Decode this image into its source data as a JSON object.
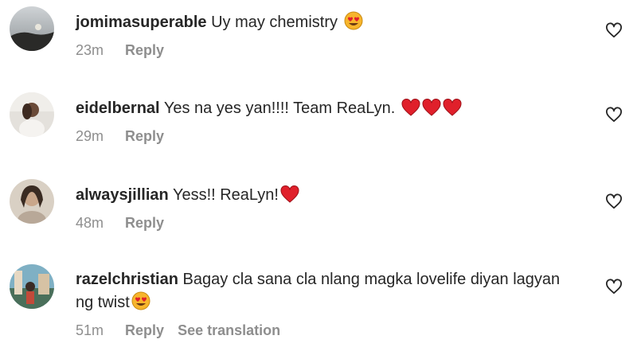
{
  "comments": [
    {
      "username": "jomimasuperable",
      "text": "Uy may chemistry",
      "emojis": [
        "heart-eyes-emoji"
      ],
      "time": "23m",
      "reply_label": "Reply",
      "translate_label": ""
    },
    {
      "username": "eidelbernal",
      "text": "Yes na yes yan!!!! Team ReaLyn.",
      "emojis": [
        "red-heart-emoji",
        "red-heart-emoji",
        "red-heart-emoji"
      ],
      "time": "29m",
      "reply_label": "Reply",
      "translate_label": ""
    },
    {
      "username": "alwaysjillian",
      "text": "Yess!! ReaLyn!",
      "emojis": [
        "red-heart-emoji"
      ],
      "time": "48m",
      "reply_label": "Reply",
      "translate_label": ""
    },
    {
      "username": "razelchristian",
      "text": "Bagay cla sana cla nlang magka lovelife diyan lagyan ng twist",
      "emojis": [
        "heart-eyes-emoji"
      ],
      "time": "51m",
      "reply_label": "Reply",
      "translate_label": "See translation"
    }
  ],
  "icons": {
    "like": "heart-outline-icon"
  },
  "colors": {
    "text": "#262626",
    "secondary": "#8e8e8e",
    "heart": "#e0202b"
  }
}
